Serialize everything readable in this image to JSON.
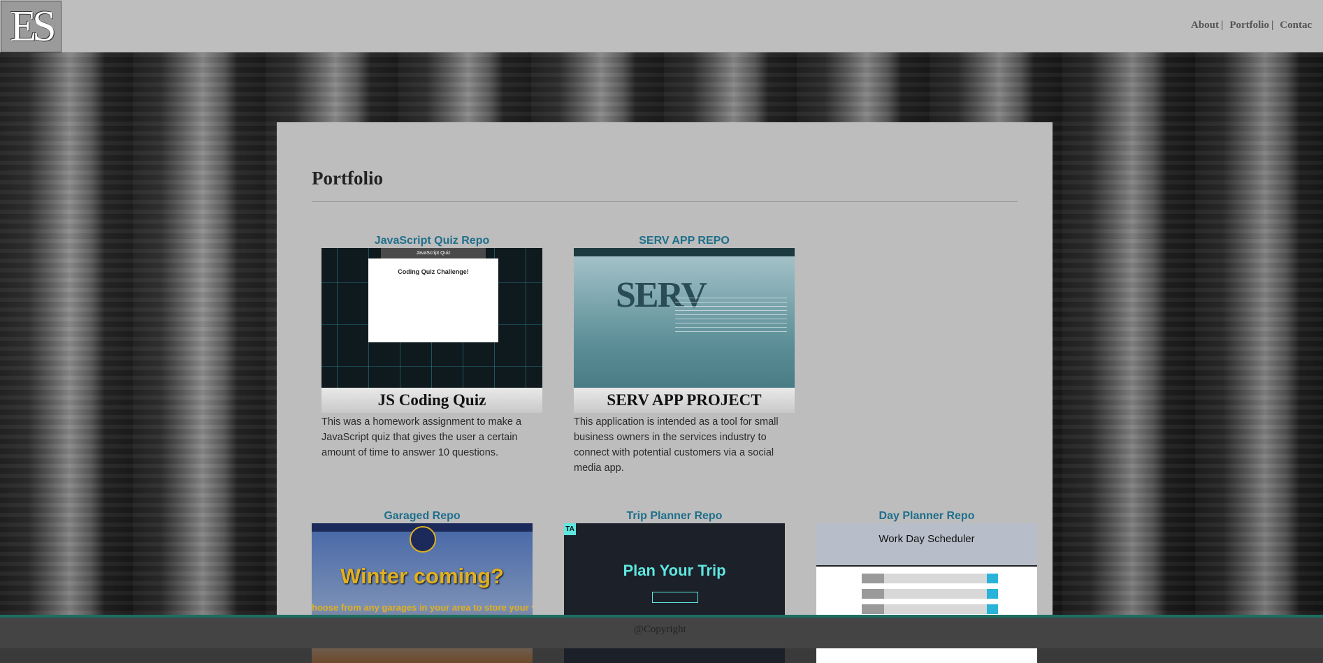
{
  "header": {
    "logo_text": "ES",
    "nav": [
      {
        "label": "About",
        "sep": "|"
      },
      {
        "label": "Portfolio",
        "sep": "|"
      },
      {
        "label": "Contac"
      }
    ]
  },
  "main": {
    "title": "Portfolio",
    "cards": [
      {
        "repo_label": "JavaScript Quiz Repo",
        "project_title": "JS Coding Quiz",
        "description": "This was a homework assignment to make a JavaScript quiz that gives the user a certain amount of time to answer 10 questions.",
        "thumb": {
          "topbar": "JavaScript Quiz",
          "heading": "Coding Quiz Challenge!"
        }
      },
      {
        "repo_label": "SERV APP REPO",
        "project_title": "SERV APP PROJECT",
        "description": "This application is intended as a tool for small business owners in the services industry to connect with potential customers via a social media app.",
        "thumb": {
          "logo": "SERV"
        }
      },
      {
        "repo_label": "Garaged Repo",
        "thumb": {
          "headline": "Winter coming?",
          "sub": "hoose from any garages in your area to store your vehic"
        }
      },
      {
        "repo_label": "Trip Planner Repo",
        "thumb": {
          "headline": "Plan Your Trip",
          "corner": "TA"
        }
      },
      {
        "repo_label": "Day Planner Repo",
        "thumb": {
          "headline": "Work Day Scheduler"
        }
      }
    ]
  },
  "footer": {
    "copyright": "@Copyright"
  },
  "colors": {
    "link": "#1f6f8b",
    "footer_accent": "#1d6e62",
    "panel": "#bdbdbd"
  }
}
